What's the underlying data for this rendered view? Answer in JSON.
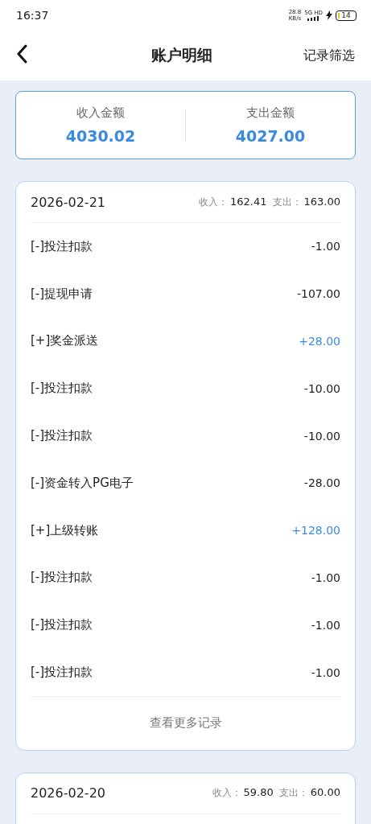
{
  "status_bar": {
    "time": "16:37",
    "net_speed": "28.8",
    "net_unit": "KB/s",
    "network": "5G HD",
    "battery": "14"
  },
  "nav": {
    "title": "账户明细",
    "action": "记录筛选"
  },
  "summary": [
    {
      "label": "收入金额",
      "value": "4030.02"
    },
    {
      "label": "支出金额",
      "value": "4027.00"
    }
  ],
  "days": [
    {
      "date": "2026-02-21",
      "income_label": "收入：",
      "income": "162.41",
      "expense_label": "支出：",
      "expense": "163.00",
      "more": "查看更多记录",
      "records": [
        {
          "name": "[-]投注扣款",
          "amount": "-1.00",
          "kind": "expense"
        },
        {
          "name": "[-]提现申请",
          "amount": "-107.00",
          "kind": "expense"
        },
        {
          "name": "[+]奖金派送",
          "amount": "+28.00",
          "kind": "income"
        },
        {
          "name": "[-]投注扣款",
          "amount": "-10.00",
          "kind": "expense"
        },
        {
          "name": "[-]投注扣款",
          "amount": "-10.00",
          "kind": "expense"
        },
        {
          "name": "[-]资金转入PG电子",
          "amount": "-28.00",
          "kind": "expense"
        },
        {
          "name": "[+]上级转账",
          "amount": "+128.00",
          "kind": "income"
        },
        {
          "name": "[-]投注扣款",
          "amount": "-1.00",
          "kind": "expense"
        },
        {
          "name": "[-]投注扣款",
          "amount": "-1.00",
          "kind": "expense"
        },
        {
          "name": "[-]投注扣款",
          "amount": "-1.00",
          "kind": "expense"
        }
      ]
    },
    {
      "date": "2026-02-20",
      "income_label": "收入：",
      "income": "59.80",
      "expense_label": "支出：",
      "expense": "60.00"
    }
  ]
}
